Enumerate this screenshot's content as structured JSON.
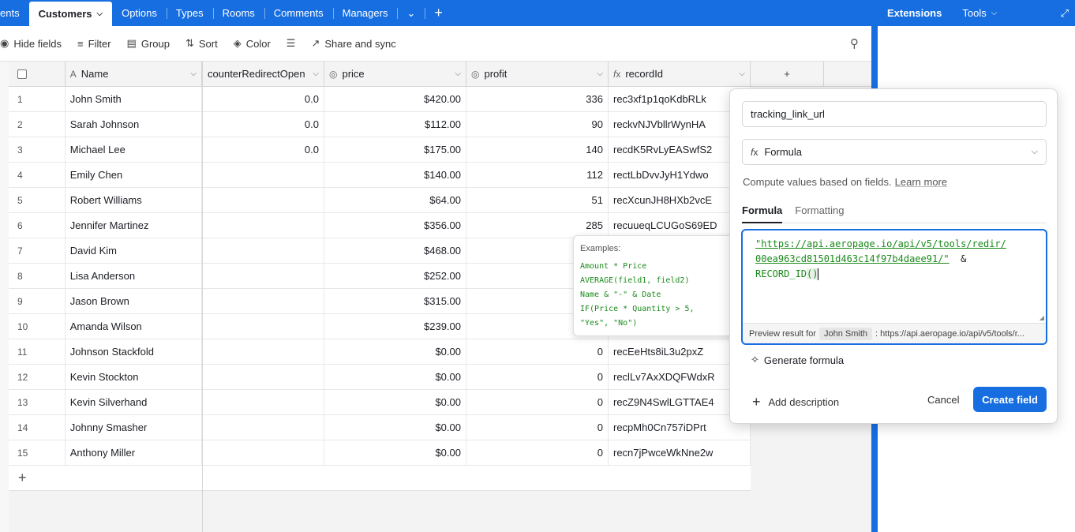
{
  "tabs": [
    {
      "label": "ents",
      "active": false
    },
    {
      "label": "Customers",
      "active": true
    },
    {
      "label": "Options",
      "active": false
    },
    {
      "label": "Types",
      "active": false
    },
    {
      "label": "Rooms",
      "active": false
    },
    {
      "label": "Comments",
      "active": false
    },
    {
      "label": "Managers",
      "active": false
    }
  ],
  "rightbar": {
    "extensions": "Extensions",
    "tools": "Tools"
  },
  "toolbar": {
    "hide_fields": "Hide fields",
    "filter": "Filter",
    "group": "Group",
    "sort": "Sort",
    "color": "Color",
    "share": "Share and sync"
  },
  "columns": {
    "name": "Name",
    "counter": "counterRedirectOpen",
    "price": "price",
    "profit": "profit",
    "record": "recordId"
  },
  "rows": [
    {
      "n": "1",
      "name": "John Smith",
      "counter": "0.0",
      "price": "$420.00",
      "profit": "336",
      "rec": "rec3xf1p1qoKdbRLk"
    },
    {
      "n": "2",
      "name": "Sarah Johnson",
      "counter": "0.0",
      "price": "$112.00",
      "profit": "90",
      "rec": "reckvNJVbllrWynHA"
    },
    {
      "n": "3",
      "name": "Michael Lee",
      "counter": "0.0",
      "price": "$175.00",
      "profit": "140",
      "rec": "recdK5RvLyEASwfS2"
    },
    {
      "n": "4",
      "name": "Emily Chen",
      "counter": "",
      "price": "$140.00",
      "profit": "112",
      "rec": "rectLbDvvJyH1Ydwo"
    },
    {
      "n": "5",
      "name": "Robert Williams",
      "counter": "",
      "price": "$64.00",
      "profit": "51",
      "rec": "recXcunJH8HXb2vcE"
    },
    {
      "n": "6",
      "name": "Jennifer Martinez",
      "counter": "",
      "price": "$356.00",
      "profit": "285",
      "rec": "recuueqLCUGoS69ED"
    },
    {
      "n": "7",
      "name": "David Kim",
      "counter": "",
      "price": "$468.00",
      "profit": "",
      "rec": ""
    },
    {
      "n": "8",
      "name": "Lisa Anderson",
      "counter": "",
      "price": "$252.00",
      "profit": "",
      "rec": ""
    },
    {
      "n": "9",
      "name": "Jason Brown",
      "counter": "",
      "price": "$315.00",
      "profit": "",
      "rec": ""
    },
    {
      "n": "10",
      "name": "Amanda Wilson",
      "counter": "",
      "price": "$239.00",
      "profit": "",
      "rec": ""
    },
    {
      "n": "11",
      "name": "Johnson Stackfold",
      "counter": "",
      "price": "$0.00",
      "profit": "0",
      "rec": "recEeHts8iL3u2pxZ"
    },
    {
      "n": "12",
      "name": "Kevin Stockton",
      "counter": "",
      "price": "$0.00",
      "profit": "0",
      "rec": "reclLv7AxXDQFWdxR"
    },
    {
      "n": "13",
      "name": "Kevin Silverhand",
      "counter": "",
      "price": "$0.00",
      "profit": "0",
      "rec": "recZ9N4SwlLGTTAE4"
    },
    {
      "n": "14",
      "name": "Johnny Smasher",
      "counter": "",
      "price": "$0.00",
      "profit": "0",
      "rec": "recpMh0Cn757iDPrt"
    },
    {
      "n": "15",
      "name": "Anthony Miller",
      "counter": "",
      "price": "$0.00",
      "profit": "0",
      "rec": "recn7jPwceWkNne2w"
    }
  ],
  "examples": {
    "title": "Examples:",
    "lines": [
      "Amount * Price",
      "AVERAGE(field1, field2)",
      "Name & \"-\" & Date",
      "IF(Price * Quantity > 5,",
      "\"Yes\", \"No\")"
    ]
  },
  "editor": {
    "field_name": "tracking_link_url",
    "field_type": "Formula",
    "description": "Compute values based on fields.",
    "learn_more": "Learn more",
    "tab_formula": "Formula",
    "tab_formatting": "Formatting",
    "formula_line1": "\"https://api.aeropage.io/api/v5/tools/redir/",
    "formula_line2": "00ea963cd81501d463c14f97b4daee91/\"",
    "formula_op": "&",
    "formula_fn": "RECORD_ID",
    "formula_paren": "()",
    "preview_label": "Preview result for",
    "preview_record": "John Smith",
    "preview_value": ": https://api.aeropage.io/api/v5/tools/r...",
    "generate": "Generate formula",
    "add_description": "Add description",
    "cancel": "Cancel",
    "create": "Create field"
  },
  "colors": {
    "accent": "#166ee1",
    "formula_green": "#1a8a1a"
  }
}
